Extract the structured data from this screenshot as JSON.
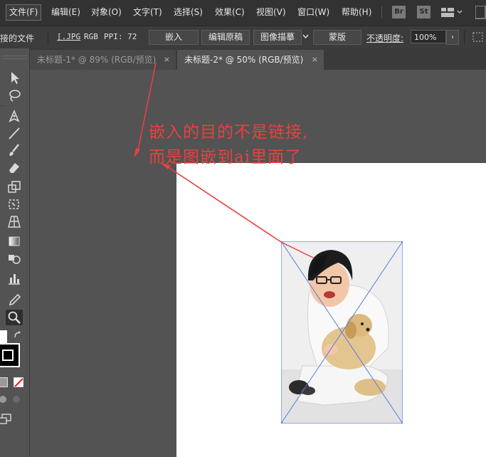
{
  "menu": [
    {
      "label": "文件(F)",
      "active": true
    },
    {
      "label": "编辑(E)"
    },
    {
      "label": "对象(O)"
    },
    {
      "label": "文字(T)"
    },
    {
      "label": "选择(S)"
    },
    {
      "label": "效果(C)"
    },
    {
      "label": "视图(V)"
    },
    {
      "label": "窗口(W)"
    },
    {
      "label": "帮助(H)"
    }
  ],
  "app_badges": {
    "bridge": "Br",
    "stock": "St"
  },
  "control": {
    "link_label": "接的文件",
    "file_name": "[.JPG",
    "color_mode": "RGB",
    "ppi": "PPI: 72",
    "embed": "嵌入",
    "edit_original": "编辑原稿",
    "image_trace": "图像描摹",
    "mask": "蒙版",
    "opacity_label": "不透明度:",
    "opacity_value": "100%"
  },
  "tabs": [
    {
      "label": "未标题-1* @ 89% (RGB/预览)",
      "close": "×",
      "active": false
    },
    {
      "label": "未标题-2* @ 50% (RGB/预览)",
      "close": "×",
      "active": true
    }
  ],
  "annotation": {
    "line1": "嵌入的目的不是链接,",
    "line2": "而是图嵌到ai里面了",
    "color": "#e8413e"
  },
  "icons": [
    "selection-tool-icon",
    "lasso-icon",
    "pen-tool-icon",
    "line-tool-icon",
    "brush-tool-icon",
    "eraser-tool-icon",
    "scale-tool-icon",
    "free-transform-icon",
    "perspective-grid-icon",
    "gradient-tool-icon",
    "shape-builder-icon",
    "graph-tool-icon",
    "eyedropper-icon",
    "zoom-tool-icon"
  ]
}
